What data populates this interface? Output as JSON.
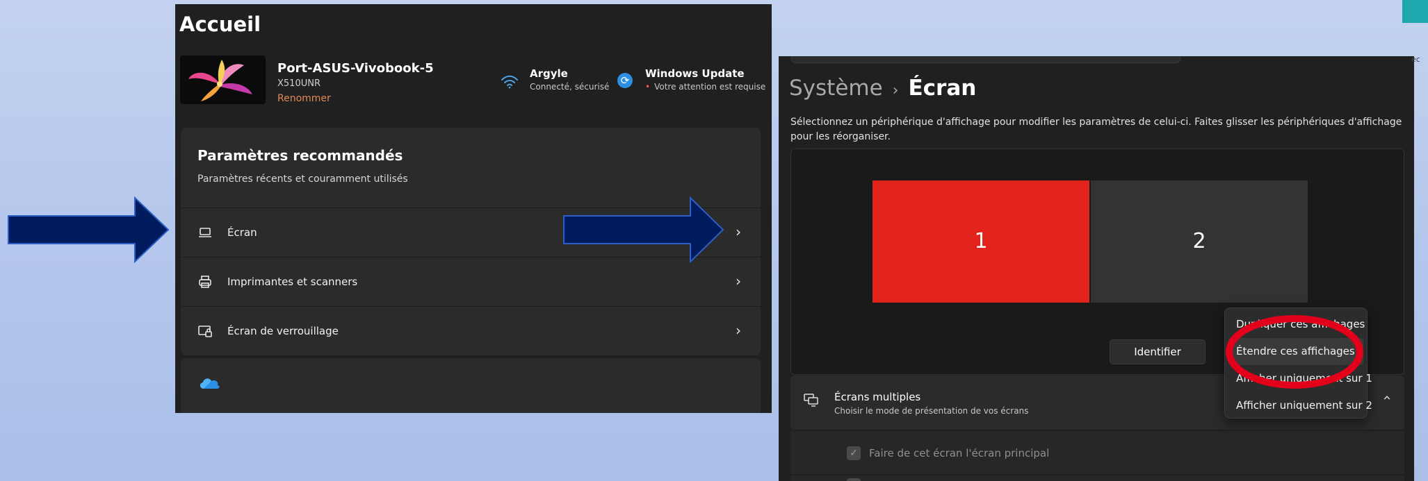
{
  "home": {
    "title": "Accueil",
    "device": {
      "name": "Port-ASUS-Vivobook-5",
      "model": "X510UNR",
      "rename_label": "Renommer"
    },
    "network": {
      "icon": "wifi-icon",
      "name": "Argyle",
      "status": "Connecté, sécurisé"
    },
    "update": {
      "icon": "windows-update-icon",
      "title": "Windows Update",
      "status": "Votre attention est requise",
      "dot": "•"
    },
    "recommended": {
      "title": "Paramètres recommandés",
      "subtitle": "Paramètres récents et couramment utilisés",
      "items": [
        {
          "label": "Écran",
          "icon": "laptop-icon"
        },
        {
          "label": "Imprimantes et scanners",
          "icon": "printer-icon"
        },
        {
          "label": "Écran de verrouillage",
          "icon": "lock-screen-icon"
        }
      ],
      "chevron": "›"
    },
    "cloud_card": {
      "icon": "onedrive-cloud-icon"
    }
  },
  "display": {
    "breadcrumb": {
      "parent": "Système",
      "separator": "›",
      "current": "Écran"
    },
    "description": "Sélectionnez un périphérique d'affichage pour modifier les paramètres de celui-ci. Faites glisser les périphériques d'affichage pour les réorganiser.",
    "monitors": [
      {
        "label": "1",
        "selected": true,
        "color": "#e1231b"
      },
      {
        "label": "2",
        "selected": false,
        "color": "#333333"
      }
    ],
    "identify_label": "Identifier",
    "dropdown_options": [
      "Dupliquer ces affichages",
      "Étendre ces affichages",
      "Afficher uniquement sur 1",
      "Afficher uniquement sur 2"
    ],
    "dropdown_selected": "Étendre ces affichages",
    "multi_screens": {
      "title": "Écrans multiples",
      "subtitle": "Choisir le mode de présentation de vos écrans",
      "chevron": "›"
    },
    "primary_display": {
      "label": "Faire de cet écran l'écran principal",
      "checked": true,
      "check_mark": "✓"
    }
  },
  "edge_label": "ec",
  "colors": {
    "accent_blue": "#4cc2ff",
    "arrow_fill": "#001b5e",
    "arrow_stroke": "#2d5fc4",
    "highlight_ring": "#e3001b",
    "selected_monitor": "#e1231b",
    "rename_link": "#e08a55",
    "teal_corner": "#1fa7ae"
  }
}
